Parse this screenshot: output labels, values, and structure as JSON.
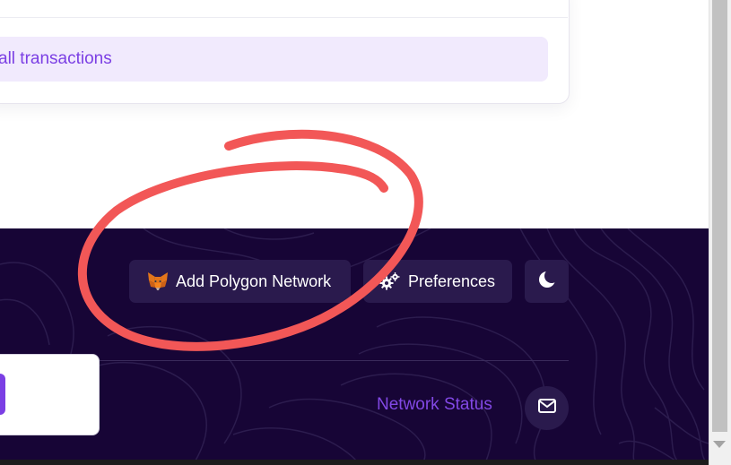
{
  "card": {
    "view_all_label": "all transactions"
  },
  "footer": {
    "add_network_label": "Add Polygon Network",
    "preferences_label": "Preferences",
    "network_status_label": "Network Status"
  },
  "icons": {
    "metamask": "metamask-fox-icon",
    "preferences": "gears-icon",
    "theme": "moon-icon",
    "mail": "envelope-icon"
  },
  "colors": {
    "footer_bg": "#170536",
    "button_bg": "#2a1a4d",
    "accent": "#7b3fe4",
    "link": "#8248e5",
    "annotation": "#f25757",
    "view_all_bg": "#f1eafd"
  }
}
